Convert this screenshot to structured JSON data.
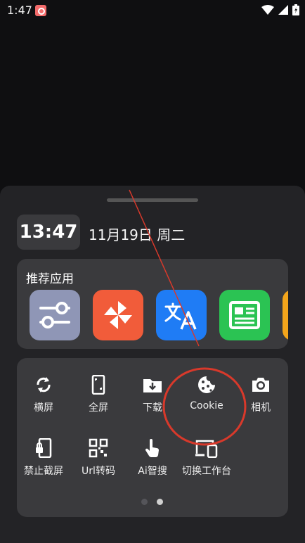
{
  "status": {
    "time": "1:47"
  },
  "panel": {
    "clock": "13:47",
    "date": "11月19日 周二",
    "recommended": {
      "title": "推荐应用",
      "apps": [
        {
          "name": "settings-app",
          "color": "#8f96b6"
        },
        {
          "name": "pinwheel-app",
          "color": "#f15c3a"
        },
        {
          "name": "translate-app",
          "color": "#1f7cf5"
        },
        {
          "name": "news-app",
          "color": "#2bc353"
        },
        {
          "name": "partial-app",
          "color": "#f3a51b"
        }
      ]
    },
    "tools": [
      {
        "label": "横屏",
        "icon": "rotate-icon"
      },
      {
        "label": "全屏",
        "icon": "phone-fullscreen-icon"
      },
      {
        "label": "下载",
        "icon": "download-folder-icon"
      },
      {
        "label": "Cookie",
        "icon": "cookie-icon"
      },
      {
        "label": "相机",
        "icon": "camera-icon"
      },
      {
        "label": "禁止截屏",
        "icon": "lock-phone-icon"
      },
      {
        "label": "Url转码",
        "icon": "qr-code-icon"
      },
      {
        "label": "Ai智搜",
        "icon": "pointer-hand-icon"
      },
      {
        "label": "切换工作台",
        "icon": "devices-icon"
      }
    ],
    "pager": {
      "active_index": 1,
      "count": 2
    }
  },
  "annotation": {
    "color": "#d8392b"
  }
}
